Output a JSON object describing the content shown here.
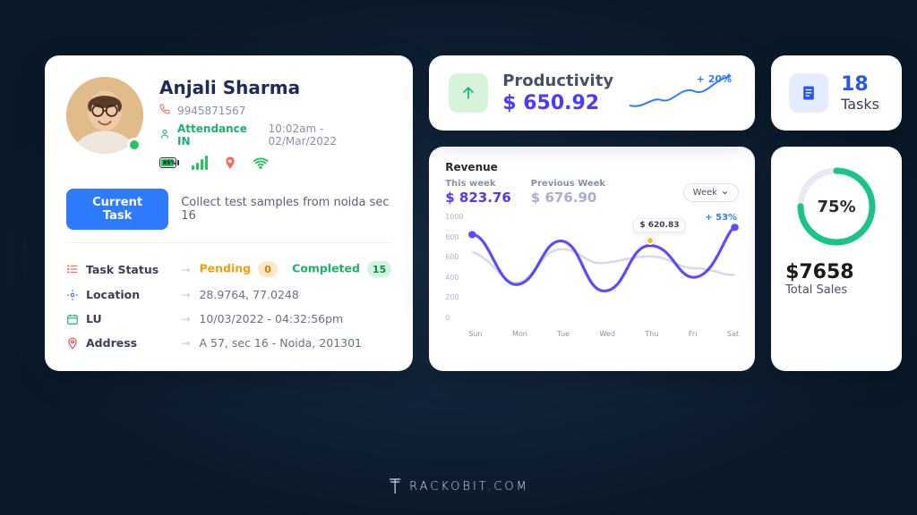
{
  "profile": {
    "name": "Anjali Sharma",
    "phone": "9945871567",
    "attendance_label": "Attendance IN",
    "attendance_value": "10:02am - 02/Mar/2022",
    "battery_pct": "85%",
    "current_task_btn": "Current Task",
    "current_task_desc": "Collect test samples from noida sec 16",
    "rows": {
      "status_label": "Task Status",
      "pending_label": "Pending",
      "pending_count": "0",
      "completed_label": "Completed",
      "completed_count": "15",
      "location_label": "Location",
      "location_value": "28.9764, 77.0248",
      "lu_label": "LU",
      "lu_value": "10/03/2022  -  04:32:56pm",
      "address_label": "Address",
      "address_value": "A 57, sec 16 - Noida, 201301"
    }
  },
  "productivity": {
    "title": "Productivity",
    "value": "$ 650.92",
    "delta": "+ 20%"
  },
  "tasks": {
    "count": "18",
    "label": "Tasks"
  },
  "revenue": {
    "title": "Revenue",
    "this_week_label": "This week",
    "this_week_value": "$ 823.76",
    "prev_week_label": "Previous Week",
    "prev_week_value": "$ 676.90",
    "dropdown": "Week",
    "tooltip": "$ 620.83",
    "delta": "+ 53%",
    "yticks": [
      "1000",
      "800",
      "600",
      "400",
      "200",
      "0"
    ],
    "xticks": [
      "Sun",
      "Mon",
      "Tue",
      "Wed",
      "Thu",
      "Fri",
      "Sat"
    ]
  },
  "sales": {
    "pct": "75%",
    "value": "$7658",
    "label": "Total Sales"
  },
  "brand": "RACKOBIT.COM",
  "chart_data": {
    "type": "line",
    "title": "Revenue",
    "xlabel": "",
    "ylabel": "",
    "ylim": [
      0,
      1000
    ],
    "categories": [
      "Sun",
      "Mon",
      "Tue",
      "Wed",
      "Thu",
      "Fri",
      "Sat"
    ],
    "series": [
      {
        "name": "This week",
        "values": [
          800,
          340,
          740,
          280,
          700,
          410,
          870
        ]
      },
      {
        "name": "Previous Week",
        "values": [
          640,
          360,
          670,
          540,
          600,
          490,
          430
        ]
      }
    ],
    "highlight": {
      "series": "This week",
      "index": 4,
      "value": 620.83
    },
    "delta_label": "+ 53%"
  }
}
